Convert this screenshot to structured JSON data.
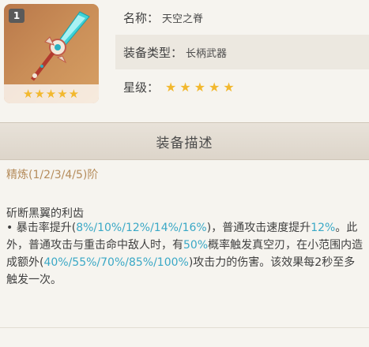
{
  "item": {
    "badge": "1",
    "stars": "★★★★★"
  },
  "info": {
    "name_label": "名称：",
    "name_value": "天空之脊",
    "type_label": "装备类型：",
    "type_value": "长柄武器",
    "rarity_label": "星级：",
    "rarity_stars": "★★★★★"
  },
  "section": {
    "title": "装备描述"
  },
  "refine": "精炼(1/2/3/4/5)阶",
  "effect": {
    "title": "斫断黑翼的利齿",
    "bullet": "• ",
    "line1_a": "暴击率提升(",
    "line1_hl": "8%/10%/12%/14%/16%",
    "line1_b": ")，普通攻击速度提升",
    "line1_hl2": "12%",
    "line1_c": "。此外，普通攻击与重击命中敌人时，有",
    "line1_hl3": "50%",
    "line1_d": "概率触发真空刃，在小范围内造成额外(",
    "line1_hl4": "40%/55%/70%/85%/100%",
    "line1_e": ")攻击力的伤害。该效果每2秒至多触发一次。"
  }
}
